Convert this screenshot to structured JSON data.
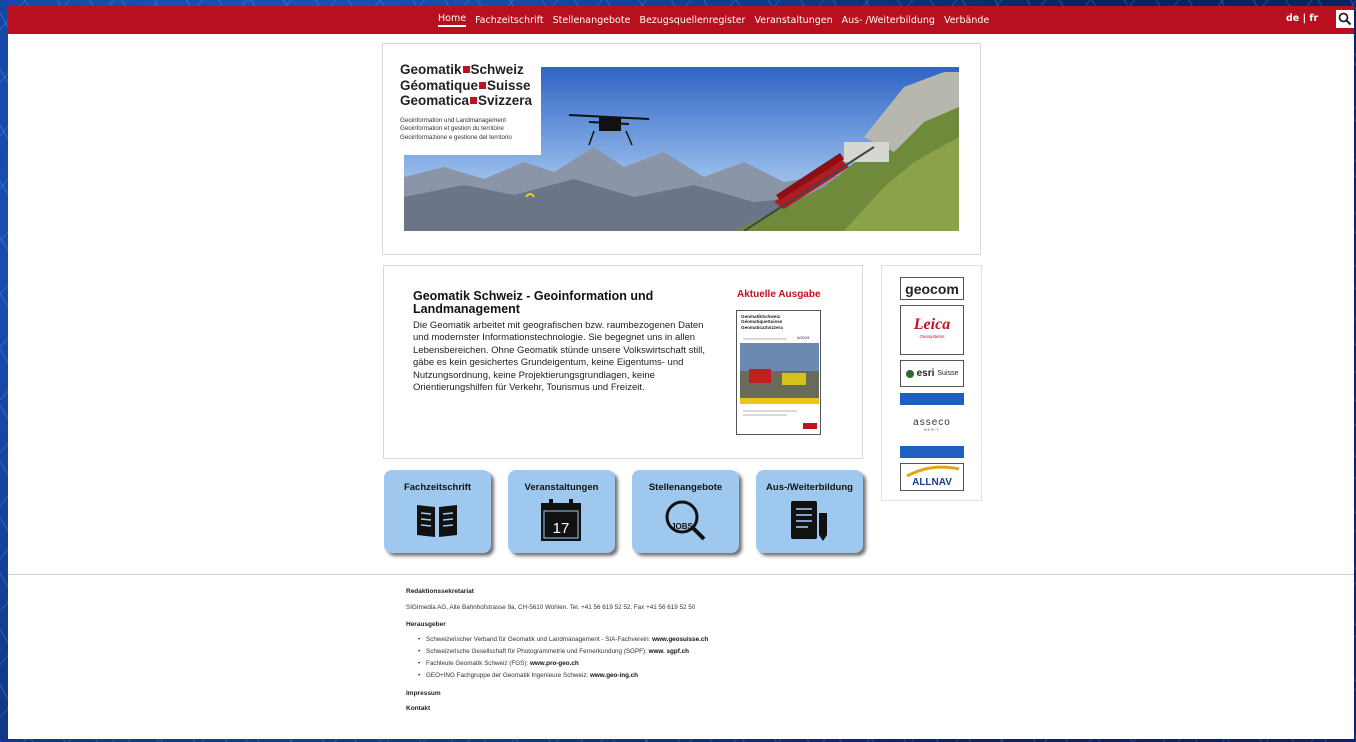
{
  "nav": {
    "items": [
      "Home",
      "Fachzeitschrift",
      "Stellenangebote",
      "Bezugsquellenregister",
      "Veranstaltungen",
      "Aus- /Weiterbildung",
      "Verbände"
    ],
    "active": "Home",
    "lang_de": "de",
    "lang_sep": "|",
    "lang_fr": "fr"
  },
  "logo": {
    "line1_a": "Geomatik",
    "line1_b": "Schweiz",
    "line2_a": "Géomatique",
    "line2_b": "Suisse",
    "line3_a": "Geomatica",
    "line3_b": "Svizzera",
    "sub1": "Geoinformation und Landmanagement",
    "sub2": "Geoinformation et gestion du territoire",
    "sub3": "Geoinformazione e gestione del territorio"
  },
  "intro": {
    "title": "Geomatik Schweiz - Geoinformation und Landmanagement",
    "text": "Die Geomatik arbeitet mit geografischen bzw. raumbezogenen Daten und modernster Informationstechnologie. Sie begegnet uns in allen Lebensbereichen. Ohne Geomatik stünde unsere Volkswirtschaft still, gäbe es kein gesichertes Grundeigentum, keine Eigentums- und Nutzungsordnung, keine Projektierungsgrundlagen, keine Orientierungshilfen für Verkehr, Tourismus und Freizeit.",
    "issue_label": "Aktuelle Ausgabe",
    "cover_l1": "GeomatikSchweiz",
    "cover_l2": "GéomatiqueSuisse",
    "cover_l3": "GeomaticaSvizzera",
    "cover_issue": "4/2019"
  },
  "sponsors": {
    "geocom": "geocom",
    "leica": "Leica",
    "leica_sub": "Geosystems",
    "esri": "esri",
    "esri_suffix": "Suisse",
    "asseco": "asseco",
    "asseco_sub": "BERIT",
    "allnav": "ALLNAV"
  },
  "tiles": [
    {
      "label": "Fachzeitschrift",
      "icon": "book-icon"
    },
    {
      "label": "Veranstaltungen",
      "icon": "calendar-icon",
      "day": "17"
    },
    {
      "label": "Stellenangebote",
      "icon": "jobs-magnifier-icon",
      "icon_text": "JOBS"
    },
    {
      "label": "Aus-/Weiterbildung",
      "icon": "training-document-icon"
    }
  ],
  "footer": {
    "h1": "Redaktionssekretariat",
    "address": "SIGImedia AG, Alte Bahnhofstrasse 9a, CH-5610 Wohlen. Tel. +41 56 619 52 52, Fax +41 56 619 52 50",
    "h2": "Herausgeber",
    "publishers": [
      {
        "text": "Schweizerischer Verband für Geomatik und Landmanagement - SIA-Fachverein:",
        "link": "www.geosuisse.ch"
      },
      {
        "text": "Schweizerische Gesellschaft für Photogrammetrie und Fernerkundung (SGPF):",
        "link": "www. sgpf.ch"
      },
      {
        "text": "Fachleute Geomatik Schweiz (FGS):",
        "link": "www.pro-geo.ch"
      },
      {
        "text": "GEO+ING Fachgruppe der Geomatik Ingenieure Schweiz:",
        "link": "www.geo-ing.ch"
      }
    ],
    "impressum": "Impressum",
    "kontakt": "Kontakt"
  }
}
